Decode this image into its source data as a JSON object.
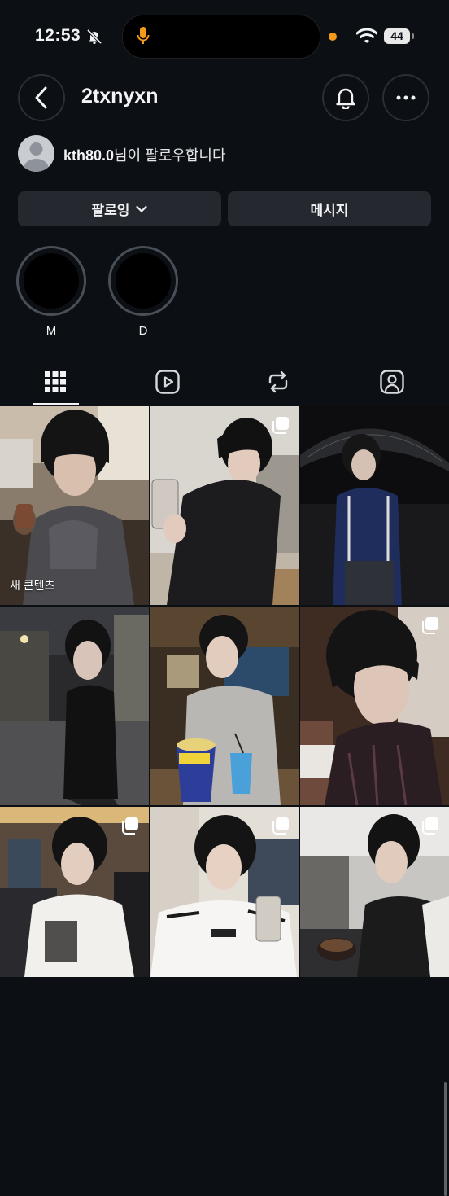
{
  "status_bar": {
    "time": "12:53",
    "battery": "44"
  },
  "header": {
    "username": "2txnyxn"
  },
  "followed_by": {
    "account": "kth80.0",
    "suffix": "님이 팔로우합니다"
  },
  "actions": {
    "following_label": "팔로잉",
    "message_label": "메시지"
  },
  "highlights": [
    {
      "label": "M"
    },
    {
      "label": "D"
    }
  ],
  "tabs": [
    "posts-grid",
    "reels",
    "reposts",
    "tagged"
  ],
  "grid": {
    "new_content_label": "새 콘텐츠",
    "posts": [
      {
        "name": "post-1",
        "multi": false
      },
      {
        "name": "post-2",
        "multi": true
      },
      {
        "name": "post-3",
        "multi": false
      },
      {
        "name": "post-4",
        "multi": false
      },
      {
        "name": "post-5",
        "multi": false
      },
      {
        "name": "post-6",
        "multi": true
      },
      {
        "name": "post-7",
        "multi": true
      },
      {
        "name": "post-8",
        "multi": true
      },
      {
        "name": "post-9",
        "multi": true
      }
    ]
  },
  "colors": {
    "background": "#0c0f14",
    "button": "#25282f",
    "accent_mic": "#f59a1b"
  }
}
